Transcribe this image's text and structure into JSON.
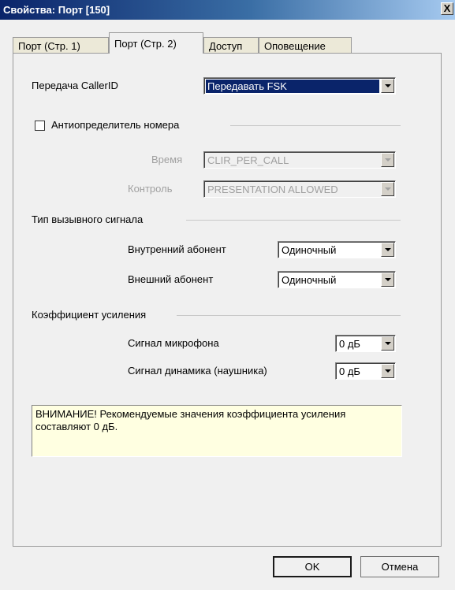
{
  "window": {
    "title": "Свойства: Порт [150]",
    "close": "X"
  },
  "tabs": [
    {
      "label": "Порт (Стр. 1)"
    },
    {
      "label": "Порт (Стр. 2)"
    },
    {
      "label": "Доступ"
    },
    {
      "label": "Оповещение"
    }
  ],
  "callerid": {
    "label": "Передача CallerID",
    "value": "Передавать FSK"
  },
  "anti": {
    "label": "Антиопределитель номера",
    "checked": false,
    "time_label": "Время",
    "time_value": "CLIR_PER_CALL",
    "control_label": "Контроль",
    "control_value": "PRESENTATION ALLOWED"
  },
  "ring": {
    "label": "Тип вызывного сигнала",
    "internal_label": "Внутренний абонент",
    "internal_value": "Одиночный",
    "external_label": "Внешний абонент",
    "external_value": "Одиночный"
  },
  "gain": {
    "label": "Коэффициент усиления",
    "mic_label": "Сигнал микрофона",
    "mic_value": "0 дБ",
    "speaker_label": "Сигнал динамика (наушника)",
    "speaker_value": "0 дБ"
  },
  "notice": "ВНИМАНИЕ! Рекомендуемые значения коэффициента усиления составляют 0 дБ.",
  "buttons": {
    "ok": "OK",
    "cancel": "Отмена"
  }
}
